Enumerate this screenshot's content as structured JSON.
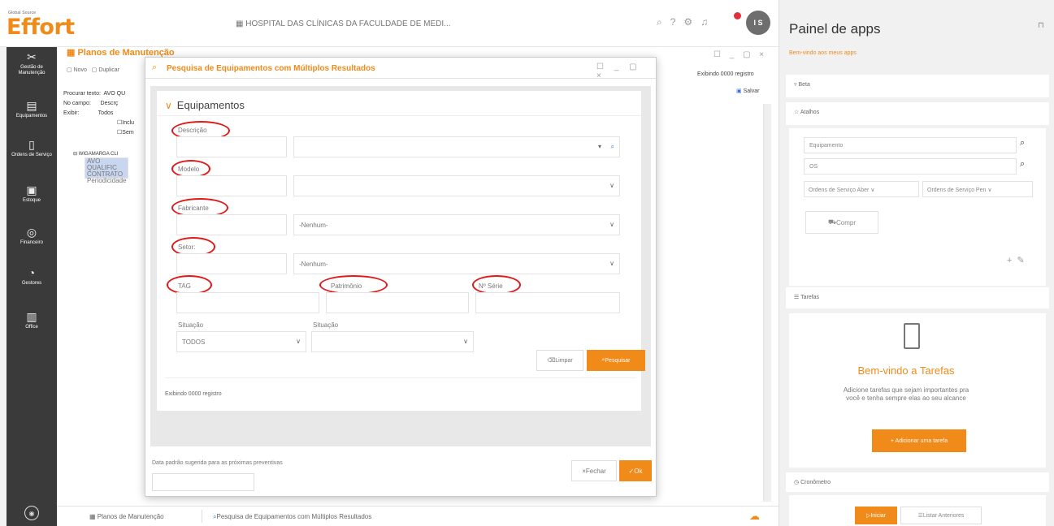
{
  "app": {
    "logo_small": "Global Source",
    "logo": "Effort",
    "header_title": "HOSPITAL DAS CLÍNICAS DA FACULDADE DE MEDI...",
    "avatar_initials": "I S",
    "accent_color": "#f08a18"
  },
  "leftnav": {
    "items": [
      {
        "label": "Gestão de Manutenção",
        "icon": "wrench-icon"
      },
      {
        "label": "Equipamentos",
        "icon": "equipment-icon"
      },
      {
        "label": "Ordens de Serviço",
        "icon": "clipboard-icon"
      },
      {
        "label": "Estoque",
        "icon": "box-icon"
      },
      {
        "label": "Financeiro",
        "icon": "money-icon"
      },
      {
        "label": "Gestores",
        "icon": "gauge-icon"
      },
      {
        "label": "Office",
        "icon": "document-icon"
      }
    ]
  },
  "background": {
    "title": "Planos de Manutenção",
    "toolbar_new": "Novo",
    "toolbar_duplicate": "Duplicar",
    "form_search_label": "Procurar texto:",
    "form_search_value": "AVO QU",
    "form_field_label": "No campo:",
    "form_field_value": "Descrç",
    "form_show_label": "Exibir:",
    "form_show_value": "Todos",
    "check1": "Inclu",
    "check2": "Sem",
    "tree_root": "WIGAMARGA CLI",
    "tree_child1": "AVO QUALIFIC",
    "tree_child2": "CONTRATO",
    "tree_child3": "Periodicidade",
    "count": "Exibindo 0000 registro",
    "save": "Salvar"
  },
  "statusbar": {
    "tab1": "Planos de Manutenção",
    "tab2": "Pesquisa de Equipamentos com Múltiplos Resultados"
  },
  "modal": {
    "title": "Pesquisa de Equipamentos com Múltiplos Resultados",
    "section": "Equipamentos",
    "fields": {
      "descricao": "Descrição",
      "modelo": "Modelo",
      "fabricante": "Fabricante",
      "fabricante_value": "-Nenhum-",
      "setor": "Setor:",
      "setor_value": "-Nenhum-",
      "tag": "TAG",
      "patrimonio": "Patrimônio",
      "serie": "Nº Série",
      "situacao1": "Situação",
      "situacao1_value": "TODOS",
      "situacao2": "Situação"
    },
    "btn_clear": "Limpar",
    "btn_search": "Pesquisar",
    "count": "Exibindo 0000 registro",
    "footer_label": "Data padrão sugerida para as próximas preventivas",
    "btn_close": "Fechar",
    "btn_ok": "Ok"
  },
  "right": {
    "title": "Painel de apps",
    "welcome": "Bem-vindo aos meus apps",
    "beta": "Beta",
    "atalhos": "Atalhos",
    "equip_input": "Equipamento",
    "os_input": "OS",
    "select1": "Ordens de Serviço Aber",
    "select2": "Ordens de Serviço Pen",
    "comprar": "Compr",
    "tarefas": "Tarefas",
    "tarefas_title": "Bem-vindo a Tarefas",
    "tarefas_desc": "Adicione tarefas que sejam importantes pra você e tenha sempre elas ao seu alcance",
    "add_task": "+ Adicionar uma tarefa",
    "cronometro": "Cronômetro",
    "iniciar": "Iniciar",
    "listar": "Listar Anteriores"
  }
}
